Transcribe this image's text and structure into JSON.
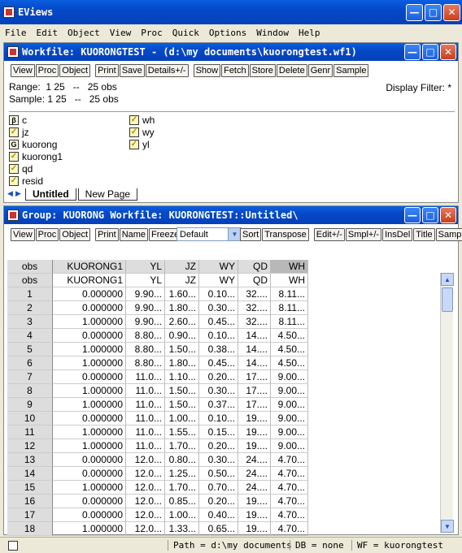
{
  "app": {
    "title": "EViews"
  },
  "menu": [
    "File",
    "Edit",
    "Object",
    "View",
    "Proc",
    "Quick",
    "Options",
    "Window",
    "Help"
  ],
  "workfile": {
    "title": "Workfile: KUORONGTEST - (d:\\my documents\\kuorongtest.wf1)",
    "toolbar": [
      "View",
      "Proc",
      "Object",
      "Print",
      "Save",
      "Details+/-",
      "Show",
      "Fetch",
      "Store",
      "Delete",
      "Genr",
      "Sample"
    ],
    "range_line": "Range:  1 25   --   25 obs",
    "sample_line": "Sample: 1 25   --   25 obs",
    "display_filter": "Display Filter: *",
    "objects_left": [
      {
        "name": "c",
        "icon": "beta-icon"
      },
      {
        "name": "jz",
        "icon": "series-icon"
      },
      {
        "name": "kuorong",
        "icon": "group-icon"
      },
      {
        "name": "kuorong1",
        "icon": "series-icon"
      },
      {
        "name": "qd",
        "icon": "series-icon"
      },
      {
        "name": "resid",
        "icon": "series-icon"
      }
    ],
    "objects_right": [
      {
        "name": "wh",
        "icon": "series-icon"
      },
      {
        "name": "wy",
        "icon": "series-icon"
      },
      {
        "name": "yl",
        "icon": "series-icon"
      }
    ],
    "tabs": [
      "Untitled",
      "New Page"
    ]
  },
  "group": {
    "title": "Group: KUORONG   Workfile: KUORONGTEST::Untitled\\",
    "toolbar_left": [
      "View",
      "Proc",
      "Object",
      "Print",
      "Name",
      "Freeze"
    ],
    "view_select": "Default",
    "toolbar_right": [
      "Sort",
      "Transpose",
      "Edit+/-",
      "Smpl+/-",
      "InsDel",
      "Title",
      "Samp"
    ],
    "columns": [
      "obs",
      "KUORONG1",
      "YL",
      "JZ",
      "WY",
      "QD",
      "WH"
    ],
    "subheader": [
      "obs",
      "KUORONG1",
      "YL",
      "JZ",
      "WY",
      "QD",
      "WH"
    ],
    "rows": [
      [
        "1",
        "0.000000",
        "9.90...",
        "1.60...",
        "0.10...",
        "32....",
        "8.11..."
      ],
      [
        "2",
        "0.000000",
        "9.90...",
        "1.80...",
        "0.30...",
        "32....",
        "8.11..."
      ],
      [
        "3",
        "1.000000",
        "9.90...",
        "2.60...",
        "0.45...",
        "32....",
        "8.11..."
      ],
      [
        "4",
        "0.000000",
        "8.80...",
        "0.90...",
        "0.10...",
        "14....",
        "4.50..."
      ],
      [
        "5",
        "1.000000",
        "8.80...",
        "1.50...",
        "0.38...",
        "14....",
        "4.50..."
      ],
      [
        "6",
        "1.000000",
        "8.80...",
        "1.80...",
        "0.45...",
        "14....",
        "4.50..."
      ],
      [
        "7",
        "0.000000",
        "11.0...",
        "1.10...",
        "0.20...",
        "17....",
        "9.00..."
      ],
      [
        "8",
        "1.000000",
        "11.0...",
        "1.50...",
        "0.30...",
        "17....",
        "9.00..."
      ],
      [
        "9",
        "1.000000",
        "11.0...",
        "1.50...",
        "0.37...",
        "17....",
        "9.00..."
      ],
      [
        "10",
        "0.000000",
        "11.0...",
        "1.00...",
        "0.10...",
        "19....",
        "9.00..."
      ],
      [
        "11",
        "1.000000",
        "11.0...",
        "1.55...",
        "0.15...",
        "19....",
        "9.00..."
      ],
      [
        "12",
        "1.000000",
        "11.0...",
        "1.70...",
        "0.20...",
        "19....",
        "9.00..."
      ],
      [
        "13",
        "0.000000",
        "12.0...",
        "0.80...",
        "0.30...",
        "24....",
        "4.70..."
      ],
      [
        "14",
        "0.000000",
        "12.0...",
        "1.25...",
        "0.50...",
        "24....",
        "4.70..."
      ],
      [
        "15",
        "1.000000",
        "12.0...",
        "1.70...",
        "0.70...",
        "24....",
        "4.70..."
      ],
      [
        "16",
        "0.000000",
        "12.0...",
        "0.85...",
        "0.20...",
        "19....",
        "4.70..."
      ],
      [
        "17",
        "0.000000",
        "12.0...",
        "1.00...",
        "0.40...",
        "19....",
        "4.70..."
      ],
      [
        "18",
        "1.000000",
        "12.0...",
        "1.33...",
        "0.65...",
        "19....",
        "4.70..."
      ]
    ]
  },
  "status": {
    "path": "Path = d:\\my documents",
    "db": "DB = none",
    "wf": "WF = kuorongtest"
  }
}
